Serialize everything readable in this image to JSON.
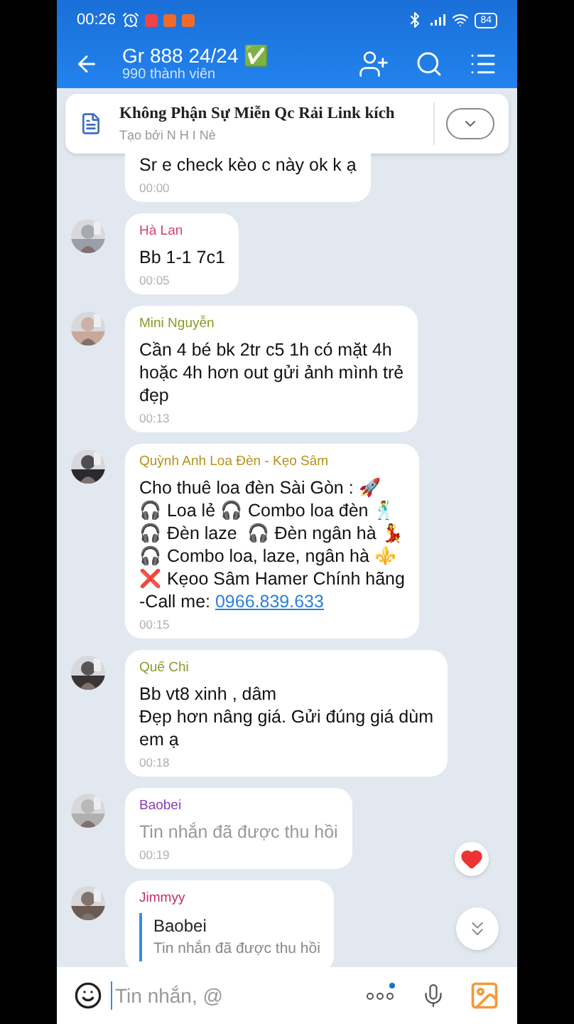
{
  "status_bar": {
    "time": "00:26",
    "battery": "84"
  },
  "header": {
    "title": "Gr 888 24/24 ✅",
    "subtitle": "990 thành viên"
  },
  "pinned": {
    "title": "Không Phận Sự Miễn Qc Rải Link kích",
    "subtitle": "Tạo bởi N H I Nè"
  },
  "messages": [
    {
      "kind": "text",
      "lines": [
        "Sr e check kèo c này ok k ạ"
      ],
      "time": "00:00"
    },
    {
      "kind": "text",
      "sender": "Hà Lan",
      "color": "#d0407a",
      "lines": [
        "Bb 1-1 7c1"
      ],
      "time": "00:05"
    },
    {
      "kind": "text",
      "sender": "Mini Nguyễn",
      "color": "#8a9a2a",
      "lines": [
        "Cần 4 bé bk 2tr c5 1h có mặt 4h",
        "hoặc 4h hơn out gửi ảnh mình trẻ",
        "đẹp"
      ],
      "time": "00:13"
    },
    {
      "kind": "text",
      "sender": "Quỳnh Anh Loa Đèn - Kẹo Sâm",
      "color": "#b8901a",
      "lines": [
        "Cho thuê loa đèn Sài Gòn : 🚀",
        "🎧 Loa lẻ 🎧 Combo loa đèn 🕺",
        "🎧 Đèn laze  🎧 Đèn ngân hà 💃",
        "🎧 Combo loa, laze, ngân hà ⚜️",
        "❌ Kẹoo Sâm Hamer Chính hãng"
      ],
      "link_prefix": "-Call me: ",
      "link": "0966.839.633",
      "time": "00:15"
    },
    {
      "kind": "text",
      "sender": "Quế Chi",
      "color": "#8a9a2a",
      "lines": [
        "Bb vt8 xinh , dâm",
        "Đẹp hơn nâng giá. Gửi đúng giá dùm",
        "em ạ"
      ],
      "time": "00:18"
    },
    {
      "kind": "recalled",
      "sender": "Baobei",
      "color": "#8a3fb0",
      "lines": [
        "Tin nhắn đã được thu hồi"
      ],
      "time": "00:19"
    },
    {
      "kind": "reply",
      "sender": "Jimmyy",
      "color": "#c0306a",
      "quote_sender": "Baobei",
      "quote_text": "Tin nhắn đã được thu hồi"
    }
  ],
  "composer": {
    "placeholder": "Tin nhắn, @"
  }
}
